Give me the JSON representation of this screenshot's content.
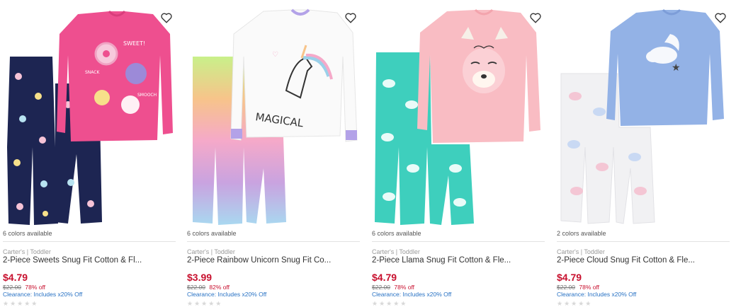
{
  "products": [
    {
      "colors": "6 colors available",
      "brand": "Carter's | Toddler",
      "name": "2-Piece Sweets Snug Fit Cotton & Fl...",
      "price": "$4.79",
      "original": "$22.00",
      "discount": "78% off",
      "clearance": "Clearance: Includes x20% Off",
      "stars": "★★★★★",
      "image_icon": "pajama-sweets-image",
      "top_color": "#ee4f8f",
      "bottom_color": "#1d2552"
    },
    {
      "colors": "6 colors available",
      "brand": "Carter's | Toddler",
      "name": "2-Piece Rainbow Unicorn Snug Fit Co...",
      "price": "$3.99",
      "original": "$22.00",
      "discount": "82% off",
      "clearance": "Clearance: Includes x20% Off",
      "stars": "★★★★★",
      "image_icon": "pajama-unicorn-image",
      "top_color": "#fafafa",
      "bottom_color": "#c9a3e0"
    },
    {
      "colors": "6 colors available",
      "brand": "Carter's | Toddler",
      "name": "2-Piece Llama Snug Fit Cotton & Fle...",
      "price": "$4.79",
      "original": "$22.00",
      "discount": "78% off",
      "clearance": "Clearance: Includes x20% Off",
      "stars": "★★★★★",
      "image_icon": "pajama-llama-image",
      "top_color": "#f9bcc3",
      "bottom_color": "#3ecfbd"
    },
    {
      "colors": "2 colors available",
      "brand": "Carter's | Toddler",
      "name": "2-Piece Cloud Snug Fit Cotton & Fle...",
      "price": "$4.79",
      "original": "$22.00",
      "discount": "78% off",
      "clearance": "Clearance: Includes x20% Off",
      "stars": "★★★★★",
      "image_icon": "pajama-cloud-image",
      "top_color": "#93b2e6",
      "bottom_color": "#f1f1f3"
    }
  ],
  "colors": {
    "price_red": "#c8102e",
    "link_blue": "#2872c4"
  }
}
